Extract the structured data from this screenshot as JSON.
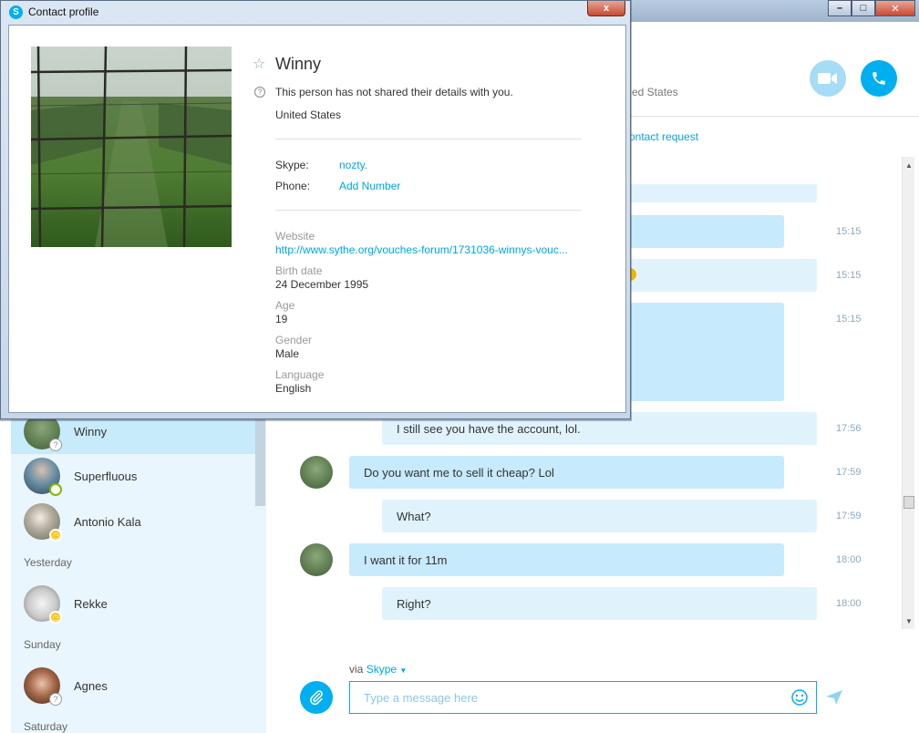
{
  "dialog": {
    "title": "Contact profile",
    "close_label": "x"
  },
  "profile": {
    "name": "Winny",
    "privacy_note": "This person has not shared their details with you.",
    "country": "United States",
    "skype_label": "Skype:",
    "skype_value": "nozty.",
    "phone_label": "Phone:",
    "phone_action": "Add Number",
    "website_label": "Website",
    "website_value": "http://www.sythe.org/vouches-forum/1731036-winnys-vouc...",
    "birth_label": "Birth date",
    "birth_value": "24 December 1995",
    "age_label": "Age",
    "age_value": "19",
    "gender_label": "Gender",
    "gender_value": "Male",
    "language_label": "Language",
    "language_value": "English"
  },
  "main_window": {
    "header_location_fragment": "ed States",
    "header_request_fragment": "ontact request"
  },
  "sidebar": {
    "contacts": [
      {
        "name": "Winny",
        "status": "unknown"
      },
      {
        "name": "Superfluous",
        "status": "online"
      },
      {
        "name": "Antonio Kala",
        "status": "away"
      }
    ],
    "yesterday_label": "Yesterday",
    "yesterday_contacts": [
      {
        "name": "Rekke",
        "status": "away"
      }
    ],
    "sunday_label": "Sunday",
    "sunday_contacts": [
      {
        "name": "Agnes",
        "status": "unknown"
      }
    ],
    "saturday_label": "Saturday"
  },
  "messages": [
    {
      "time": "15:15",
      "text": ""
    },
    {
      "time": "15:15",
      "text": ""
    },
    {
      "time": "15:15",
      "text": ""
    },
    {
      "time": "17:56",
      "text": "I still see you have the account, lol."
    },
    {
      "time": "17:59",
      "text": "Do you want me to sell it cheap? Lol"
    },
    {
      "time": "17:59",
      "text": "What?"
    },
    {
      "time": "18:00",
      "text": "I want it for 11m"
    },
    {
      "time": "18:00",
      "text": "Right?"
    }
  ],
  "compose": {
    "via_label": "via",
    "via_service": "Skype",
    "placeholder": "Type a message here"
  },
  "colors": {
    "accent": "#00aff0",
    "bubble_theirs": "#c7eafc",
    "bubble_mine": "#e0f3fd"
  }
}
